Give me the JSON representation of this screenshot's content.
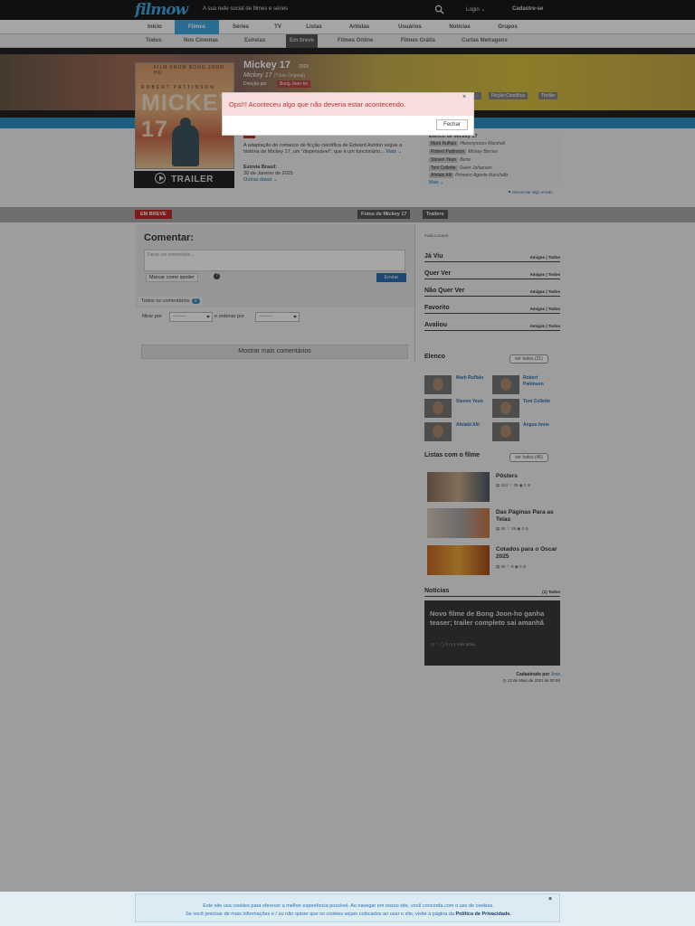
{
  "header": {
    "logo": "filmow",
    "tagline": "A sua rede social de filmes e séries",
    "login": "Login ⌄",
    "signup": "Cadastre-se"
  },
  "nav": [
    "Início",
    "Filmes",
    "Séries",
    "TV",
    "Listas",
    "Artistas",
    "Usuários",
    "Notícias",
    "Grupos"
  ],
  "subnav": [
    "Todos",
    "Nos Cinemas",
    "Estreias",
    "Em breve",
    "Filmes Online",
    "Filmes Grátis",
    "Curtas Metragens"
  ],
  "movie": {
    "title": "Mickey 17",
    "year": "2025",
    "original_title": "Mickey 17",
    "original_note": "(Título Original)",
    "director_label": "Direção por",
    "director": "Bong Joon-ho",
    "genres": [
      "...",
      "Ficção Científica",
      "Thriller"
    ],
    "synopsis": "A adaptação do romance de ficção científica de Edward Ashton segue a história de Mickey 17, um \"dispensável\", que é um funcionário...",
    "synopsis_more": "Mais ⌄",
    "release_label": "Estreia Brasil:",
    "release_date": "30 de Janeiro de 2025",
    "other_dates": "Outras datas ⌄",
    "trailer_label": "TRAILER",
    "poster_topline": "FILM FROM BONG JOON HO",
    "poster_name": "ROBERT PATTINSON",
    "poster_title": "MICKEY 17"
  },
  "cast_box": {
    "heading": "Elenco de Mickey 17",
    "rows": [
      {
        "actor": "Mark Ruffalo",
        "role": "Hieronymous Marshall"
      },
      {
        "actor": "Robert Pattinson",
        "role": "Mickey Barnes"
      },
      {
        "actor": "Steven Yeun",
        "role": "Berto"
      },
      {
        "actor": "Toni Collette",
        "role": "Gwen Johansen"
      },
      {
        "actor": "Afolabi Alli",
        "role": "Primeiro Agente Marshalls"
      }
    ],
    "more": "Mais ⌄",
    "report": "⚑ Denunciar algo errado"
  },
  "tabs": {
    "em_breve": "EM BREVE",
    "fotos": "Fotos de Mickey 17",
    "trailers": "Trailers"
  },
  "comments": {
    "heading": "Comentar:",
    "placeholder": "Deixe um comentário...",
    "spoiler_label": "Marcar como spoiler",
    "info": "?",
    "submit": "Enviar",
    "all_label": "Todos os comentários",
    "all_count": "0",
    "filter_label": "filtrar por",
    "order_label": "e ordenar por",
    "filter_value": "---------",
    "order_value": "---------",
    "more": "Mostrar mais comentários"
  },
  "sidebar": {
    "publicidade": "PUBLICIDADE",
    "rates": [
      {
        "label": "Já Viu",
        "links": "Amigos | Todos"
      },
      {
        "label": "Quer Ver",
        "links": "Amigos | Todos"
      },
      {
        "label": "Não Quer Ver",
        "links": "Amigos | Todos"
      },
      {
        "label": "Favorito",
        "links": "Amigos | Todos"
      },
      {
        "label": "Avaliou",
        "links": "Amigos | Todos"
      }
    ],
    "cast_title": "Elenco",
    "cast_ver_todos": "ver todos (31)",
    "cast": [
      "Mark Ruffalo",
      "Robert Pattinson",
      "Steven Yeun",
      "Toni Collette",
      "Afolabi Alli",
      "Angus Imrie"
    ],
    "lists_title": "Listas com o filme",
    "lists_ver_todos": "ver todos (46)",
    "lists": [
      {
        "name": "Pôsters",
        "stats": "▤ 313   ♡ 39   ◉ 0   ⊘"
      },
      {
        "name": "Das Páginas Para as Telas",
        "stats": "▤ 46   ♡ 19   ◉ 0   ⊘"
      },
      {
        "name": "Cotados para o Oscar 2025",
        "stats": "▤ 26   ♡ 8   ◉ 0   ⊘"
      }
    ],
    "news_title": "Notícias",
    "news_link": "(1) Todos",
    "news_text": "Novo filme de Bong Joon-ho ganha teaser; trailer completo sai amanhã",
    "news_meta": "0 ♡     ◯ 0     ◷ 1 mês atrás",
    "created_by_label": "Cadastrado por",
    "created_by": "Jess",
    "created_date": "◷ 13 de Maio de 2021 às 00:46"
  },
  "modal": {
    "message": "Ops!!! Aconteceu algo que não deveria estar acontecendo.",
    "close": "×",
    "button": "Fechar"
  },
  "cookie": {
    "line1": "Este site usa cookies para oferecer a melhor experiência possível. Ao navegar em nosso site, você concorda com o uso de cookies.",
    "line2": "Se você precisar de mais informações e / ou não quiser que os cookies sejam colocados ao usar o site, visite a página da",
    "policy": "Política de Privacidade.",
    "close": "×"
  },
  "colors": {
    "accent": "#3fa9e0",
    "alert": "#b83232",
    "badge_red": "#c02828"
  }
}
